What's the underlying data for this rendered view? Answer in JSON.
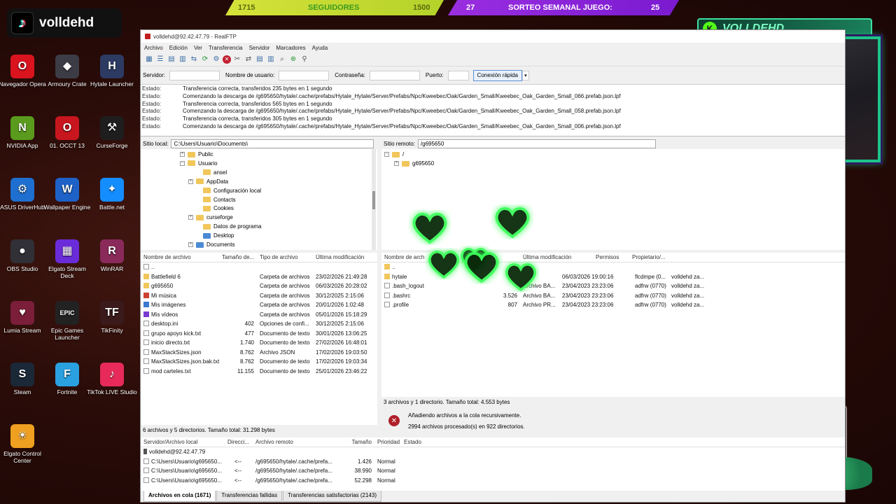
{
  "overlay": {
    "stream_name": "volldehd",
    "followers_current": "1715",
    "followers_label": "SEGUIDORES",
    "followers_goal": "1500",
    "raffle_left": "27",
    "raffle_label": "SORTEO SEMANAL JUEGO:",
    "raffle_right": "25",
    "cam_name": "VOLLDEHD"
  },
  "desktop": {
    "icons": [
      {
        "label": "Navegador Opera",
        "symbol": "O",
        "color": "#d9141e"
      },
      {
        "label": "Armoury Crate",
        "symbol": "◆",
        "color": "#3c3c46"
      },
      {
        "label": "Hytale Launcher",
        "symbol": "H",
        "color": "#2d3b63"
      },
      {
        "label": "NVIDIA App",
        "symbol": "N",
        "color": "#5a9b1e"
      },
      {
        "label": "01. OCCT 13",
        "symbol": "O",
        "color": "#c8161e"
      },
      {
        "label": "CurseForge",
        "symbol": "⚒",
        "color": "#1e1e1e"
      },
      {
        "label": "ASUS DriverHub",
        "symbol": "⚙",
        "color": "#1e6fd0"
      },
      {
        "label": "Wallpaper Engine",
        "symbol": "W",
        "color": "#1e62c8"
      },
      {
        "label": "Battle.net",
        "symbol": "✦",
        "color": "#148eff"
      },
      {
        "label": "OBS Studio",
        "symbol": "●",
        "color": "#303036"
      },
      {
        "label": "Elgato Stream Deck",
        "symbol": "▦",
        "color": "#6a2cd8"
      },
      {
        "label": "WinRAR",
        "symbol": "R",
        "color": "#8a2a5a"
      },
      {
        "label": "Lumia Stream",
        "symbol": "♥",
        "color": "#7a1e3a"
      },
      {
        "label": "Epic Games Launcher",
        "symbol": "EPIC",
        "color": "#222"
      },
      {
        "label": "TikFinity",
        "symbol": "TF",
        "color": "#3a1a1a"
      },
      {
        "label": "Steam",
        "symbol": "S",
        "color": "#1b2838"
      },
      {
        "label": "Fortnite",
        "symbol": "F",
        "color": "#2aa0e0"
      },
      {
        "label": "TikTok LIVE Studio",
        "symbol": "♪",
        "color": "#e82a5a"
      },
      {
        "label": "Elgato Control Center",
        "symbol": "☀",
        "color": "#f0a020"
      }
    ]
  },
  "window": {
    "title": "volldehd@92.42.47.79 - RealFTP",
    "menu": [
      "Archivo",
      "Edición",
      "Ver",
      "Transferencia",
      "Servidor",
      "Marcadores",
      "Ayuda"
    ],
    "quick": {
      "server_label": "Servidor:",
      "user_label": "Nombre de usuario:",
      "pass_label": "Contraseña:",
      "port_label": "Puerto:",
      "connect_label": "Conexión rápida",
      "dropdown_icon": "▾"
    },
    "log": [
      {
        "k": "Estado:",
        "v": "Transferencia correcta, transferidos 235 bytes en 1 segundo"
      },
      {
        "k": "Estado:",
        "v": "Comenzando la descarga de /g695650/hytale/.cache/prefabs/Hytale_Hytale/Server/Prefabs/Npc/Kweebec/Oak/Garden_Small/Kweebec_Oak_Garden_Small_066.prefab.json.lpf"
      },
      {
        "k": "Estado:",
        "v": "Transferencia correcta, transferidos 565 bytes en 1 segundo"
      },
      {
        "k": "Estado:",
        "v": "Comenzando la descarga de /g695650/hytale/.cache/prefabs/Hytale_Hytale/Server/Prefabs/Npc/Kweebec/Oak/Garden_Small/Kweebec_Oak_Garden_Small_058.prefab.json.lpf"
      },
      {
        "k": "Estado:",
        "v": "Transferencia correcta, transferidos 305 bytes en 1 segundo"
      },
      {
        "k": "Estado:",
        "v": "Comenzando la descarga de /g695650/hytale/.cache/prefabs/Hytale_Hytale/Server/Prefabs/Npc/Kweebec/Oak/Garden_Small/Kweebec_Oak_Garden_Small_006.prefab.json.lpf"
      }
    ],
    "local": {
      "site_label": "Sitio local:",
      "site_path": "C:\\Users\\Usuario\\Documents\\",
      "tree": [
        "Public",
        "Usuario",
        "ansel",
        "AppData",
        "Configuración local",
        "Contacts",
        "Cookies",
        "curseforge",
        "Datos de programa",
        "Desktop",
        "Documents"
      ],
      "headers": [
        "Nombre de archivo",
        "Tamaño de...",
        "Tipo de archivo",
        "Última modificación"
      ],
      "files": [
        {
          "name": "..",
          "size": "",
          "type": "",
          "date": ""
        },
        {
          "name": "Battlefield 6",
          "size": "",
          "type": "Carpeta de archivos",
          "date": "23/02/2026 21:49:28"
        },
        {
          "name": "g695650",
          "size": "",
          "type": "Carpeta de archivos",
          "date": "06/03/2026 20:28:02"
        },
        {
          "name": "Mi música",
          "size": "",
          "type": "Carpeta de archivos",
          "date": "30/12/2025 2:15:06"
        },
        {
          "name": "Mis imágenes",
          "size": "",
          "type": "Carpeta de archivos",
          "date": "20/01/2026 1:02:48"
        },
        {
          "name": "Mis vídeos",
          "size": "",
          "type": "Carpeta de archivos",
          "date": "05/01/2026 15:18:29"
        },
        {
          "name": "desktop.ini",
          "size": "402",
          "type": "Opciones de confi...",
          "date": "30/12/2025 2:15:06"
        },
        {
          "name": "grupo apoyo kick.txt",
          "size": "477",
          "type": "Documento de texto",
          "date": "30/01/2026 13:06:25"
        },
        {
          "name": "inicio directo.txt",
          "size": "1.740",
          "type": "Documento de texto",
          "date": "27/02/2026 16:48:01"
        },
        {
          "name": "MaxStackSizes.json",
          "size": "8.762",
          "type": "Archivo JSON",
          "date": "17/02/2026 19:03:50"
        },
        {
          "name": "MaxStackSizes.json.bak.txt",
          "size": "8.762",
          "type": "Documento de texto",
          "date": "17/02/2026 19:03:34"
        },
        {
          "name": "mod carteles.txt",
          "size": "11.155",
          "type": "Documento de texto",
          "date": "25/01/2026 23:46:22"
        }
      ],
      "status": "6 archivos y 5 directorios. Tamaño total: 31.298 bytes"
    },
    "remote": {
      "site_label": "Sitio remoto:",
      "site_path": "/g695650",
      "tree": [
        "/",
        "g695650"
      ],
      "headers": [
        "Nombre de arch",
        "Tipo de arc...",
        "Última modificación",
        "Permisos",
        "Propietario/..."
      ],
      "files": [
        {
          "name": "..",
          "size": "",
          "type": "",
          "date": "",
          "perm": "",
          "owner": ""
        },
        {
          "name": "hytale",
          "size": "",
          "type": "",
          "date": "06/03/2026 19:00:16",
          "perm": "flcdmpe (0...",
          "owner": "volldehd za..."
        },
        {
          "name": ".bash_logout",
          "size": "",
          "type": "Archivo BA...",
          "date": "23/04/2023 23:23:06",
          "perm": "adfrw (0770)",
          "owner": "volldehd za..."
        },
        {
          "name": ".bashrc",
          "size": "3.526",
          "type": "Archivo BA...",
          "date": "23/04/2023 23:23:06",
          "perm": "adfrw (0770)",
          "owner": "volldehd za..."
        },
        {
          "name": ".profile",
          "size": "807",
          "type": "Archivo PR...",
          "date": "23/04/2023 23:23:06",
          "perm": "adfrw (0770)",
          "owner": "volldehd za..."
        }
      ],
      "status": "3 archivos y 1 directorio. Tamaño total: 4.553 bytes"
    },
    "notice": {
      "line1": "Añadiendo archivos a la cola recursivamente.",
      "line2": "2994 archivos procesado(s) en 922 directorios."
    },
    "queue": {
      "headers": [
        "Servidor/Archivo local",
        "Direcci...",
        "Archivo remoto",
        "Tamaño",
        "Prioridad",
        "Estado"
      ],
      "server": "volldehd@92.42.47.79",
      "rows": [
        {
          "local": "C:\\Users\\Usuario\\g695650...",
          "dir": "<--",
          "remote": "/g695650/hytale/.cache/prefa...",
          "size": "1.426",
          "prio": "Normal"
        },
        {
          "local": "C:\\Users\\Usuario\\g695650...",
          "dir": "<--",
          "remote": "/g695650/hytale/.cache/prefa...",
          "size": "38.990",
          "prio": "Normal"
        },
        {
          "local": "C:\\Users\\Usuario\\g695650...",
          "dir": "<--",
          "remote": "/g695650/hytale/.cache/prefa...",
          "size": "52.298",
          "prio": "Normal"
        }
      ],
      "tabs": [
        "Archivos en cola (1671)",
        "Transferencias fallidas",
        "Transferencias satisfactorias (2143)"
      ]
    }
  }
}
